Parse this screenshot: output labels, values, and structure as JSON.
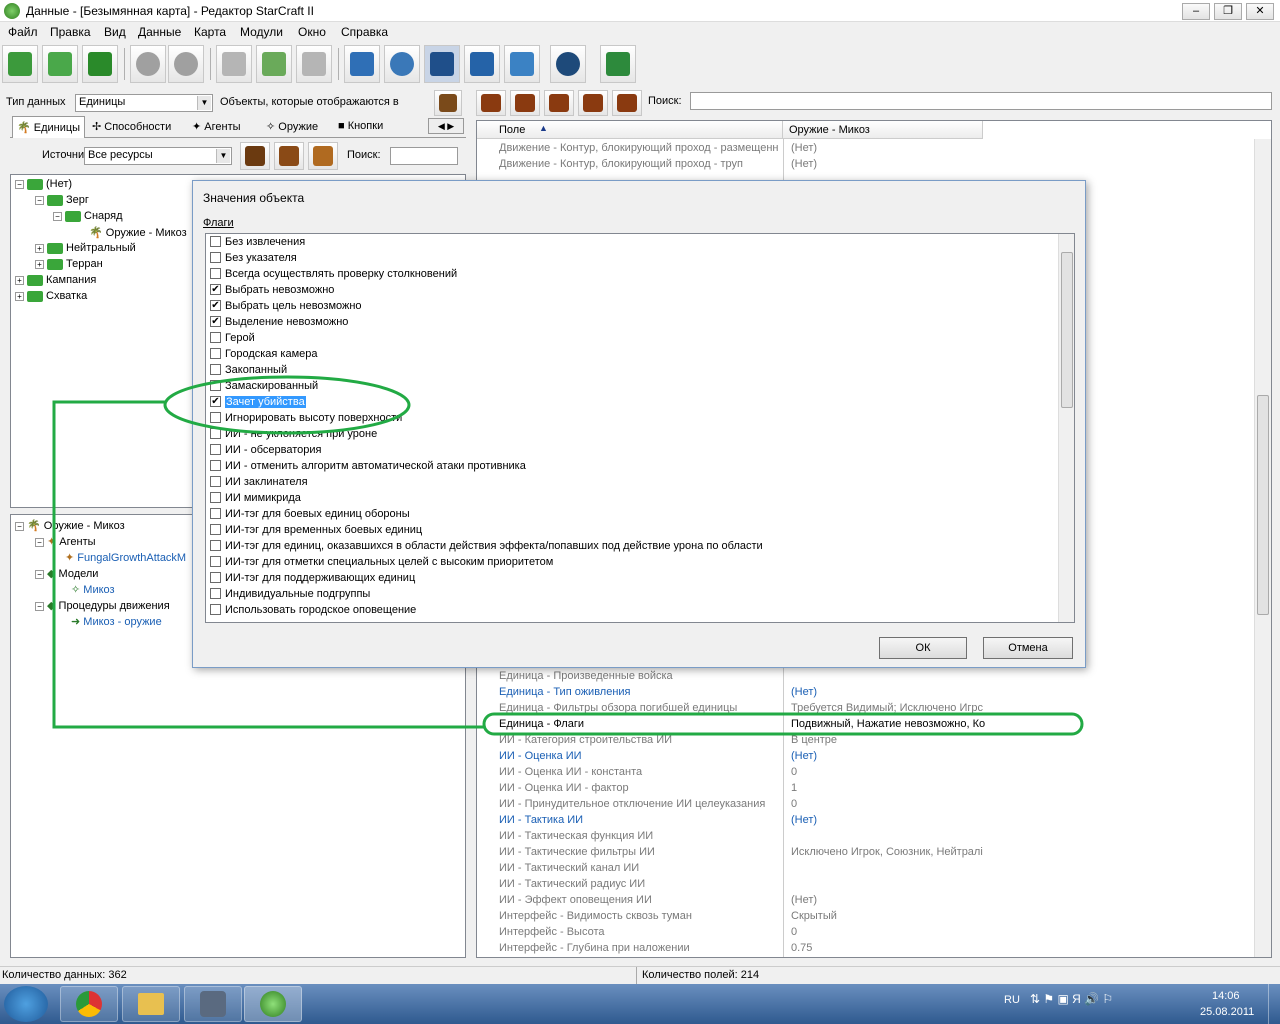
{
  "window": {
    "title": "Данные - [Безымянная карта] - Редактор StarCraft II"
  },
  "menu": [
    "Файл",
    "Правка",
    "Вид",
    "Данные",
    "Карта",
    "Модули",
    "Окно",
    "Справка"
  ],
  "left": {
    "data_type_label": "Тип данных",
    "data_type_value": "Единицы",
    "objects_label": "Объекты, которые отображаются в",
    "tabs": [
      "Единицы",
      "Способности",
      "Агенты",
      "Оружие",
      "Кнопки"
    ],
    "source_label": "Источник",
    "source_value": "Все ресурсы",
    "search_label": "Поиск:",
    "tree": [
      {
        "label": "(Нет)",
        "depth": 0
      },
      {
        "label": "Зерг",
        "depth": 1
      },
      {
        "label": "Снаряд",
        "depth": 2
      },
      {
        "label": "Оружие - Микоз",
        "depth": 3
      },
      {
        "label": "Нейтральный",
        "depth": 1
      },
      {
        "label": "Терран",
        "depth": 1
      },
      {
        "label": "Кампания",
        "depth": 0
      },
      {
        "label": "Схватка",
        "depth": 0
      }
    ],
    "tree2": [
      {
        "label": "Оружие - Микоз",
        "depth": 0
      },
      {
        "label": "Агенты",
        "depth": 1
      },
      {
        "label": "FungalGrowthAttackM",
        "depth": 2,
        "blue": true
      },
      {
        "label": "Модели",
        "depth": 1
      },
      {
        "label": "Микоз",
        "depth": 2,
        "blue": true
      },
      {
        "label": "Процедуры движения",
        "depth": 1
      },
      {
        "label": "Микоз - оружие",
        "depth": 2,
        "blue": true
      }
    ]
  },
  "right": {
    "search_label": "Поиск:",
    "col_field": "Поле",
    "col_value": "Оружие - Микоз",
    "rows_top": [
      {
        "name": "Движение - Контур, блокирующий проход - размещенн",
        "value": "(Нет)"
      },
      {
        "name": "Движение - Контур, блокирующий проход - труп",
        "value": "(Нет)"
      }
    ],
    "rows_bottom": [
      {
        "name": "Единица - Произведенные войска",
        "value": "",
        "style": "grey"
      },
      {
        "name": "Единица - Тип оживления",
        "value": "(Нет)",
        "style": "blue"
      },
      {
        "name": "Единица - Фильтры обзора погибшей единицы",
        "value": "Требуется Видимый; Исключено Игрс",
        "style": "grey"
      },
      {
        "name": "Единица - Флаги",
        "value": "Подвижный, Нажатие невозможно, Ко",
        "style": "black"
      },
      {
        "name": "ИИ - Категория строительства ИИ",
        "value": "В центре",
        "style": "grey"
      },
      {
        "name": "ИИ - Оценка ИИ",
        "value": "(Нет)",
        "style": "blue"
      },
      {
        "name": "ИИ - Оценка ИИ - константа",
        "value": "0",
        "style": "grey"
      },
      {
        "name": "ИИ - Оценка ИИ - фактор",
        "value": "1",
        "style": "grey"
      },
      {
        "name": "ИИ - Принудительное отключение ИИ целеуказания",
        "value": "0",
        "style": "grey"
      },
      {
        "name": "ИИ - Тактика ИИ",
        "value": "(Нет)",
        "style": "blue"
      },
      {
        "name": "ИИ - Тактическая функция ИИ",
        "value": "",
        "style": "grey"
      },
      {
        "name": "ИИ - Тактические фильтры ИИ",
        "value": "Исключено Игрок, Союзник, Нейтралі",
        "style": "grey"
      },
      {
        "name": "ИИ - Тактический канал ИИ",
        "value": "",
        "style": "grey"
      },
      {
        "name": "ИИ - Тактический радиус ИИ",
        "value": "",
        "style": "grey"
      },
      {
        "name": "ИИ - Эффект оповещения ИИ",
        "value": "(Нет)",
        "style": "grey"
      },
      {
        "name": "Интерфейс - Видимость сквозь туман",
        "value": "Скрытый",
        "style": "grey"
      },
      {
        "name": "Интерфейс - Высота",
        "value": "0",
        "style": "grey"
      },
      {
        "name": "Интерфейс - Глубина при наложении",
        "value": "0.75",
        "style": "grey"
      }
    ]
  },
  "dialog": {
    "title": "Значения объекта",
    "section": "Флаги",
    "flags": [
      {
        "label": "Без извлечения",
        "checked": false
      },
      {
        "label": "Без указателя",
        "checked": false
      },
      {
        "label": "Всегда осуществлять проверку столкновений",
        "checked": false
      },
      {
        "label": "Выбрать невозможно",
        "checked": true
      },
      {
        "label": "Выбрать цель невозможно",
        "checked": true
      },
      {
        "label": "Выделение невозможно",
        "checked": true
      },
      {
        "label": "Герой",
        "checked": false
      },
      {
        "label": "Городская камера",
        "checked": false
      },
      {
        "label": "Закопанный",
        "checked": false
      },
      {
        "label": "Замаскированный",
        "checked": false
      },
      {
        "label": "Зачет убийства",
        "checked": true,
        "selected": true
      },
      {
        "label": "Игнорировать высоту поверхности",
        "checked": false
      },
      {
        "label": "ИИ - не уклоняется при уроне",
        "checked": false
      },
      {
        "label": "ИИ - обсерватория",
        "checked": false
      },
      {
        "label": "ИИ - отменить алгоритм автоматической атаки противника",
        "checked": false
      },
      {
        "label": "ИИ заклинателя",
        "checked": false
      },
      {
        "label": "ИИ мимикрида",
        "checked": false
      },
      {
        "label": "ИИ-тэг для боевых единиц обороны",
        "checked": false
      },
      {
        "label": "ИИ-тэг для временных боевых единиц",
        "checked": false
      },
      {
        "label": "ИИ-тэг для единиц, оказавшихся в области действия эффекта/попавших под действие урона по области",
        "checked": false
      },
      {
        "label": "ИИ-тэг для отметки специальных целей с высоким приоритетом",
        "checked": false
      },
      {
        "label": "ИИ-тэг для поддерживающих единиц",
        "checked": false
      },
      {
        "label": "Индивидуальные подгруппы",
        "checked": false
      },
      {
        "label": "Использовать городское оповещение",
        "checked": false
      }
    ],
    "ok": "ОК",
    "cancel": "Отмена"
  },
  "status": {
    "left": "Количество данных: 362",
    "right": "Количество полей: 214"
  },
  "tray": {
    "lang": "RU",
    "time": "14:06",
    "date": "25.08.2011"
  },
  "colors": {
    "annotation": "#22aa44",
    "selection": "#3399ff"
  }
}
